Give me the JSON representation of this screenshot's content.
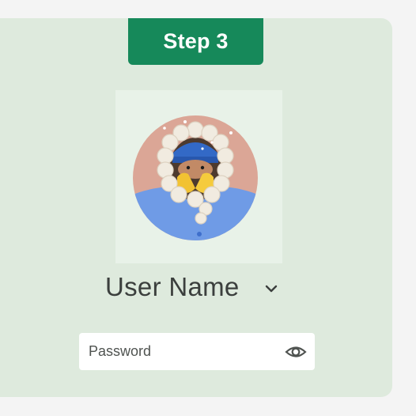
{
  "step_badge": {
    "label": "Step 3",
    "color": "#16895a"
  },
  "avatar": {
    "icon": "avatar-hooded-character"
  },
  "user": {
    "name": "User Name",
    "dropdown_icon": "chevron-down-icon"
  },
  "password": {
    "placeholder": "Password",
    "value": "",
    "visibility_icon": "eye-icon"
  },
  "colors": {
    "panel_background": "#deeadd",
    "page_background": "#f4f4f4",
    "accent": "#16895a"
  }
}
